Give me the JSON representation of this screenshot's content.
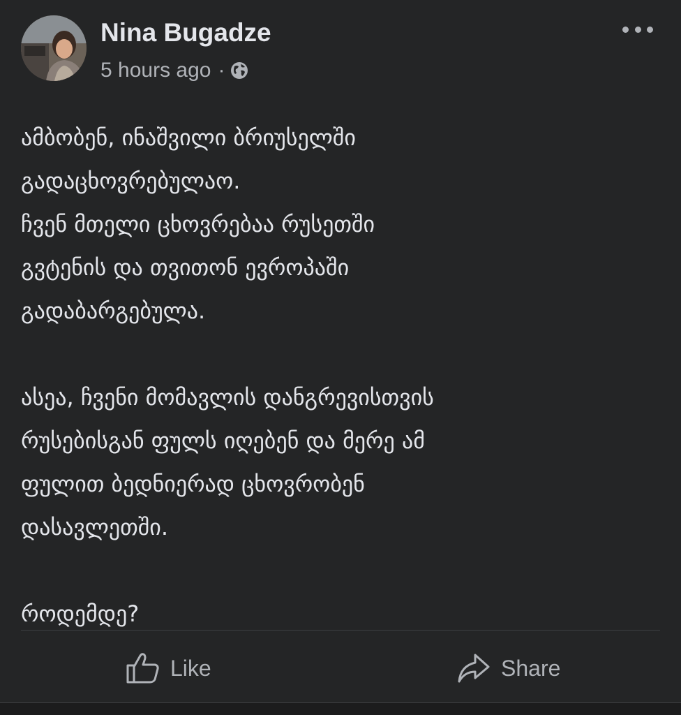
{
  "post": {
    "author": "Nina Bugadze",
    "time": "5 hours ago",
    "separator": "·",
    "privacy_icon": "globe-icon",
    "more_icon": "more-options-icon",
    "paragraphs": [
      [
        "ამბობენ, ინაშვილი ბრიუსელში",
        "გადაცხოვრებულაო.",
        "ჩვენ მთელი ცხოვრებაა რუსეთში",
        "გვტენის და თვითონ ევროპაში",
        "გადაბარგებულა."
      ],
      [
        "ასეა, ჩვენი მომავლის დანგრევისთვის",
        "რუსებისგან ფულს იღებენ და მერე ამ",
        "ფულით ბედნიერად ცხოვრობენ",
        "დასავლეთში."
      ],
      [
        "როდემდე?"
      ]
    ]
  },
  "actions": {
    "like_label": "Like",
    "share_label": "Share"
  },
  "colors": {
    "background": "#242526",
    "primary_text": "#e4e6eb",
    "secondary_text": "#b0b3b8",
    "divider": "#3e4042"
  }
}
